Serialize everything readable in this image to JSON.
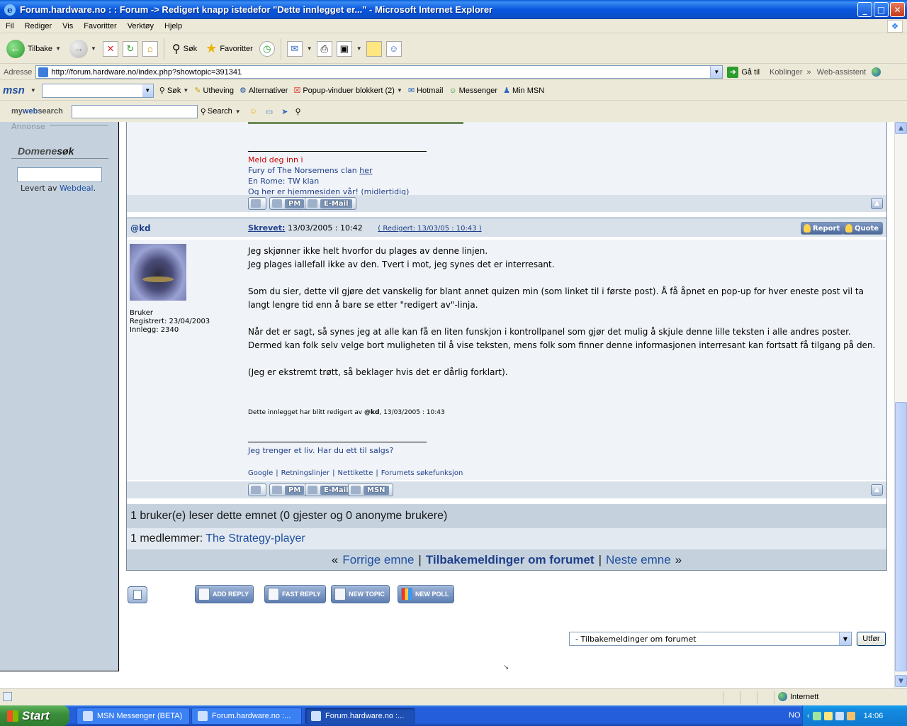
{
  "window": {
    "title": "Forum.hardware.no : : Forum -> Redigert knapp istedefor \"Dette innlegget er...\" - Microsoft Internet Explorer",
    "min": "_",
    "max": "□",
    "close": "✕"
  },
  "menu": [
    "Fil",
    "Rediger",
    "Vis",
    "Favoritter",
    "Verktøy",
    "Hjelp"
  ],
  "toolbar": {
    "back": "Tilbake",
    "search": "Søk",
    "favorites": "Favoritter"
  },
  "address": {
    "label": "Adresse",
    "url": "http://forum.hardware.no/index.php?showtopic=391341",
    "go": "Gå til",
    "links": "Koblinger",
    "assistant": "Web-assistent"
  },
  "msn": {
    "logo": "msn",
    "search": "Søk",
    "highlight": "Utheving",
    "options": "Alternativer",
    "popup": "Popup-vinduer blokkert (2)",
    "hotmail": "Hotmail",
    "messenger": "Messenger",
    "mymsn": "Min MSN"
  },
  "websearch": {
    "logo_my": "my",
    "logo_web": "web",
    "logo_search": "search",
    "button": "Search"
  },
  "sidebar": {
    "annonse": "Annonse",
    "domene_a": "Domene",
    "domene_b": "søk",
    "levert": "Levert av",
    "webdeal": "Webdeal",
    "dot": "."
  },
  "prev_post": {
    "sig_red": "Meld deg inn i",
    "sig_line2_a": "Fury of The Norsemens clan",
    "sig_line2_link": "her",
    "sig_line3": "En Rome: TW klan",
    "sig_line4_a": "Og",
    "sig_line4_link": "her",
    "sig_line4_b": "er hjemmesiden vår! (midlertidig)",
    "pm": "PM",
    "email": "E-Mail"
  },
  "post": {
    "author": "@kd",
    "skrevet": "Skrevet:",
    "date": "13/03/2005 : 10:42",
    "redigert": "( Redigert: 13/03/05 : 10:43 )",
    "report": "Report",
    "quote": "Quote",
    "rank": "Bruker",
    "registered": "Registrert: 23/04/2003",
    "posts": "Innlegg: 2340",
    "p1_l1": "Jeg skjønner ikke helt hvorfor du plages av denne linjen.",
    "p1_l2": "Jeg plages iallefall ikke av den. Tvert i mot, jeg synes det er interresant.",
    "p2": "Som du sier, dette vil gjøre det vanskelig for blant annet quizen min (som linket til i første post). Å få åpnet en pop-up for hver eneste post vil ta langt lengre tid enn å bare se etter \"redigert av\"-linja.",
    "p3": "Når det er sagt, så synes jeg at alle kan få en liten funskjon i kontrollpanel som gjør det mulig å skjule denne lille teksten i alle andres poster. Dermed kan folk selv velge bort muligheten til å vise teksten, mens folk som finner denne informasjonen interresant kan fortsatt få tilgang på den.",
    "p4": "(Jeg er ekstremt trøtt, så beklager hvis det er dårlig forklart).",
    "edit_note_a": "Dette innlegget har blitt redigert av",
    "edit_note_user": "@kd",
    "edit_note_b": ", 13/03/2005 : 10:43",
    "sig": "Jeg trenger et liv. Har du ett til salgs?",
    "links": [
      "Google",
      "Retningslinjer",
      "Nettikette",
      "Forumets søkefunksjon"
    ],
    "link_sep": "|",
    "pm": "PM",
    "email": "E-Mail",
    "msn": "MSN"
  },
  "readers": "1 bruker(e) leser dette emnet (0 gjester og 0 anonyme brukere)",
  "members_label": "1 medlemmer:",
  "members_name": "The Strategy-player",
  "nav": {
    "prev": "Forrige emne",
    "current": "Tilbakemeldinger om forumet",
    "next": "Neste emne",
    "laquo": "«",
    "raquo": "»",
    "sep": "|"
  },
  "actions": {
    "add_reply": "ADD REPLY",
    "fast_reply": "FAST REPLY",
    "new_topic": "NEW TOPIC",
    "new_poll": "NEW POLL"
  },
  "jump": {
    "selected": "- Tilbakemeldinger om forumet",
    "go": "Utfør"
  },
  "status": {
    "zone": "Internett"
  },
  "taskbar": {
    "start": "Start",
    "tasks": [
      "MSN Messenger (BETA)",
      "Forum.hardware.no :...",
      "Forum.hardware.no :..."
    ],
    "lang": "NO",
    "time": "14:06"
  }
}
